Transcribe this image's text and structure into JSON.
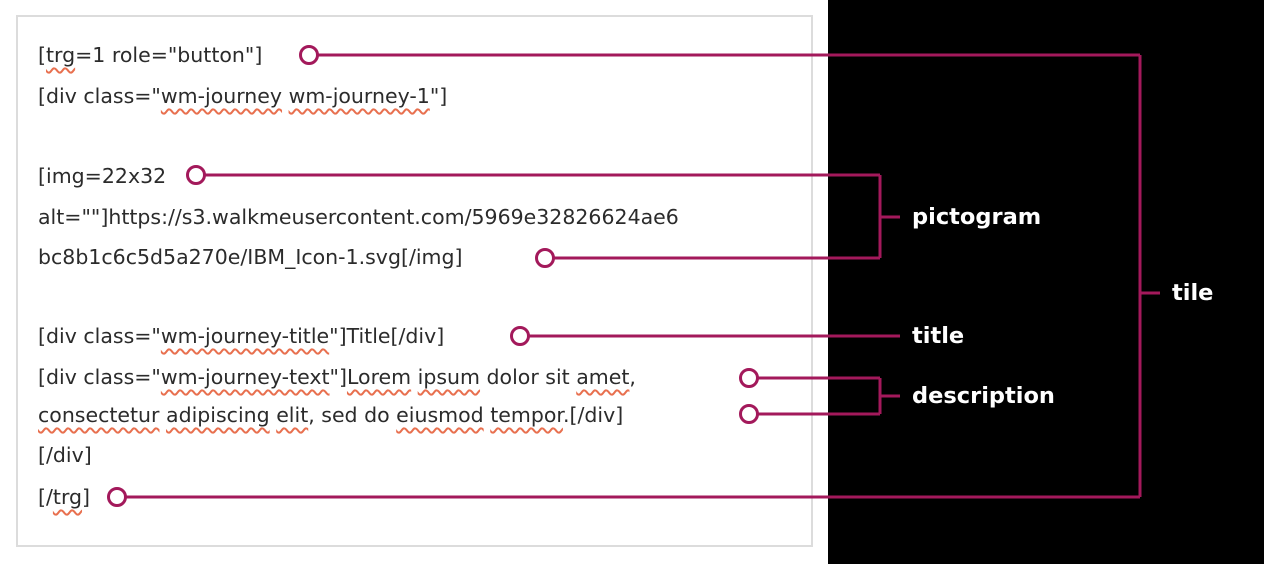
{
  "colors": {
    "connector": "#a3195b",
    "panel": "#000000",
    "spellcheck": "#e8704f"
  },
  "code": {
    "l1": {
      "a": "[",
      "b": "trg",
      "c": "=1 role=\"button\"]"
    },
    "l2": {
      "a": "[div class=\"",
      "b": "wm-journey",
      "c": " ",
      "d": "wm-journey-1",
      "e": "\"]"
    },
    "l3": "[img=22x32",
    "l4": "alt=\"\"]https://s3.walkmeusercontent.com/5969e32826624ae6",
    "l5": "bc8b1c6c5d5a270e/IBM_Icon-1.svg[/img]",
    "l6": {
      "a": "[div class=\"",
      "b": "wm-journey-title",
      "c": "\"]Title[/div]"
    },
    "l7": {
      "a": "[div class=\"",
      "b": "wm-journey-text",
      "c": "\"]",
      "d": "Lorem",
      "e": " ",
      "f": "ipsum",
      "g": " dolor sit ",
      "h": "amet",
      "i": ","
    },
    "l8": {
      "a": "consectetur",
      "b": " ",
      "c": "adipiscing",
      "d": " ",
      "e": "elit",
      "f": ", sed do ",
      "g": "eiusmod",
      "h": " ",
      "i": "tempor",
      "j": ".[/div]"
    },
    "l9": "[/div]",
    "l10": {
      "a": "[/",
      "b": "trg",
      "c": "]"
    }
  },
  "annotations": {
    "pictogram": "pictogram",
    "tile": "tile",
    "title": "title",
    "description": "description"
  }
}
